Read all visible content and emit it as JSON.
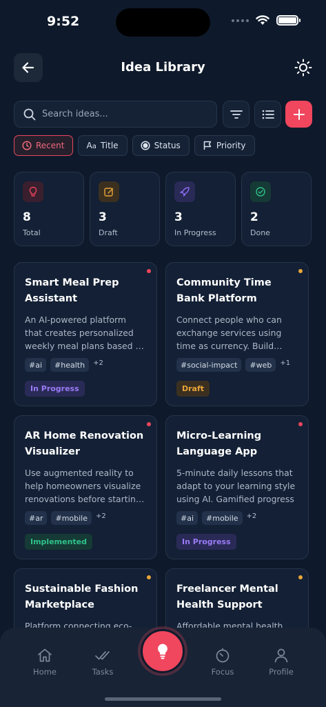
{
  "status_bar": {
    "time": "9:52"
  },
  "header": {
    "title": "Idea Library"
  },
  "search": {
    "placeholder": "Search ideas..."
  },
  "sort_chips": [
    {
      "label": "Recent",
      "icon": "clock-icon",
      "active": true
    },
    {
      "label": "Title",
      "icon": "text-size-icon",
      "active": false
    },
    {
      "label": "Status",
      "icon": "radio-circle-icon",
      "active": false
    },
    {
      "label": "Priority",
      "icon": "flag-icon",
      "active": false
    }
  ],
  "stats": [
    {
      "value": "8",
      "label": "Total",
      "icon": "lightbulb-icon",
      "color": "#f0465e"
    },
    {
      "value": "3",
      "label": "Draft",
      "icon": "edit-icon",
      "color": "#e8a53a"
    },
    {
      "value": "3",
      "label": "In Progress",
      "icon": "rocket-icon",
      "color": "#8b6cf0"
    },
    {
      "value": "2",
      "label": "Done",
      "icon": "check-circle-icon",
      "color": "#2ec28a"
    }
  ],
  "ideas": [
    {
      "title": "Smart Meal Prep Assistant",
      "description": "An AI-powered platform that creates personalized weekly meal plans based on dietary needs",
      "tags": [
        "#ai",
        "#health"
      ],
      "more": "+2",
      "status": "In Progress",
      "priority_color": "#f0465e"
    },
    {
      "title": "Community Time Bank Platform",
      "description": "Connect people who can exchange services using time as currency. Build community trust",
      "tags": [
        "#social-impact",
        "#web"
      ],
      "more": "+1",
      "status": "Draft",
      "priority_color": "#e8a53a"
    },
    {
      "title": "AR Home Renovation Visualizer",
      "description": "Use augmented reality to help homeowners visualize renovations before starting work",
      "tags": [
        "#ar",
        "#mobile"
      ],
      "more": "+2",
      "status": "Implemented",
      "priority_color": "#f0465e"
    },
    {
      "title": "Micro-Learning Language App",
      "description": "5-minute daily lessons that adapt to your learning style using AI. Gamified progress",
      "tags": [
        "#ai",
        "#mobile"
      ],
      "more": "+2",
      "status": "In Progress",
      "priority_color": "#f0465e"
    },
    {
      "title": "Sustainable Fashion Marketplace",
      "description": "Platform connecting eco-conscious shoppers with sustainable brands",
      "tags": [],
      "more": "",
      "status": "",
      "priority_color": "#e8a53a"
    },
    {
      "title": "Freelancer Mental Health Support",
      "description": "Affordable mental health support for freelancers",
      "tags": [],
      "more": "",
      "status": "",
      "priority_color": "#e8a53a"
    }
  ],
  "status_colors": {
    "In Progress": {
      "bg": "#2a2a57",
      "fg": "#9a7cf5"
    },
    "Draft": {
      "bg": "#3b3020",
      "fg": "#e8a53a"
    },
    "Implemented": {
      "bg": "#163a35",
      "fg": "#2ec28a"
    }
  },
  "bottom_nav": [
    {
      "label": "Home",
      "icon": "home-icon"
    },
    {
      "label": "Tasks",
      "icon": "check-double-icon"
    },
    {
      "label": "Focus",
      "icon": "timer-icon"
    },
    {
      "label": "Profile",
      "icon": "user-icon"
    }
  ],
  "fab": {
    "icon": "lightbulb-icon"
  }
}
